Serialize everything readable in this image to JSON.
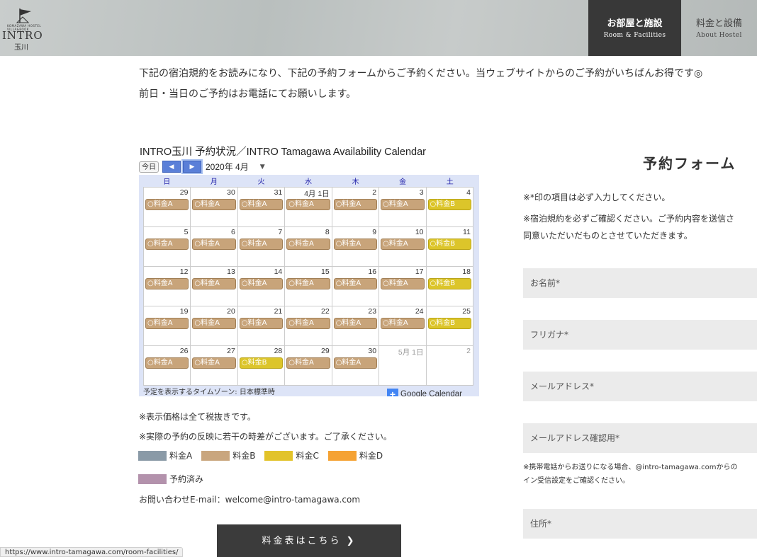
{
  "header": {
    "logo_small_text": "KOMAZAWA HOSTEL VILLA&BOOK",
    "logo_text": "INTRO",
    "logo_sub": "玉川",
    "nav": [
      {
        "jp": "お部屋と施設",
        "en": "Room & Facilities"
      },
      {
        "jp": "料金と設備",
        "en": "About Hostel"
      }
    ]
  },
  "intro": {
    "line1": "下記の宿泊規約をお読みになり、下記の予約フォームからご予約ください。当ウェブサイトからのご予約がいちばんお得です◎",
    "line2": "前日・当日のご予約はお電話にてお願いします。"
  },
  "calendar": {
    "title": "INTRO玉川 予約状況／INTRO Tamagawa Availability Calendar",
    "today_label": "今日",
    "prev_icon": "◀",
    "next_icon": "▶",
    "month_label": "2020年 4月",
    "dropdown_icon": "▼",
    "weekdays": [
      "日",
      "月",
      "火",
      "水",
      "木",
      "金",
      "土"
    ],
    "weeks": [
      [
        {
          "d": "29",
          "e": "○料金A",
          "t": "A"
        },
        {
          "d": "30",
          "e": "○料金A",
          "t": "A"
        },
        {
          "d": "31",
          "e": "○料金A",
          "t": "A"
        },
        {
          "d": "4月 1日",
          "e": "○料金A",
          "t": "A"
        },
        {
          "d": "2",
          "e": "○料金A",
          "t": "A"
        },
        {
          "d": "3",
          "e": "○料金A",
          "t": "A"
        },
        {
          "d": "4",
          "e": "○料金B",
          "t": "B"
        }
      ],
      [
        {
          "d": "5",
          "e": "○料金A",
          "t": "A"
        },
        {
          "d": "6",
          "e": "○料金A",
          "t": "A"
        },
        {
          "d": "7",
          "e": "○料金A",
          "t": "A"
        },
        {
          "d": "8",
          "e": "○料金A",
          "t": "A"
        },
        {
          "d": "9",
          "e": "○料金A",
          "t": "A"
        },
        {
          "d": "10",
          "e": "○料金A",
          "t": "A"
        },
        {
          "d": "11",
          "e": "○料金B",
          "t": "B"
        }
      ],
      [
        {
          "d": "12",
          "e": "○料金A",
          "t": "A"
        },
        {
          "d": "13",
          "e": "○料金A",
          "t": "A"
        },
        {
          "d": "14",
          "e": "○料金A",
          "t": "A"
        },
        {
          "d": "15",
          "e": "○料金A",
          "t": "A"
        },
        {
          "d": "16",
          "e": "○料金A",
          "t": "A"
        },
        {
          "d": "17",
          "e": "○料金A",
          "t": "A"
        },
        {
          "d": "18",
          "e": "○料金B",
          "t": "B"
        }
      ],
      [
        {
          "d": "19",
          "e": "○料金A",
          "t": "A"
        },
        {
          "d": "20",
          "e": "○料金A",
          "t": "A"
        },
        {
          "d": "21",
          "e": "○料金A",
          "t": "A"
        },
        {
          "d": "22",
          "e": "○料金A",
          "t": "A"
        },
        {
          "d": "23",
          "e": "○料金A",
          "t": "A"
        },
        {
          "d": "24",
          "e": "○料金A",
          "t": "A"
        },
        {
          "d": "25",
          "e": "○料金B",
          "t": "B"
        }
      ],
      [
        {
          "d": "26",
          "e": "○料金A",
          "t": "A"
        },
        {
          "d": "27",
          "e": "○料金A",
          "t": "A"
        },
        {
          "d": "28",
          "e": "○料金B",
          "t": "B"
        },
        {
          "d": "29",
          "e": "○料金A",
          "t": "A"
        },
        {
          "d": "30",
          "e": "○料金A",
          "t": "A"
        },
        {
          "d": "5月 1日",
          "e": "",
          "t": "",
          "other": true
        },
        {
          "d": "2",
          "e": "",
          "t": "",
          "other": true
        }
      ]
    ],
    "footer_text": "予定を表示するタイムゾーン: 日本標準時",
    "gcal_plus": "+",
    "gcal_label": "Google Calendar"
  },
  "notes": {
    "tax": "※表示価格は全て税抜きです。",
    "delay": "※実際の予約の反映に若干の時差がございます。ご了承ください。"
  },
  "legend": [
    {
      "label": "料金A",
      "color": "#8a9aa7"
    },
    {
      "label": "料金B",
      "color": "#c9a67e"
    },
    {
      "label": "料金C",
      "color": "#e2c32a"
    },
    {
      "label": "料金D",
      "color": "#f5a233"
    },
    {
      "label": "予約済み",
      "color": "#b392ac"
    }
  ],
  "contact": "お問い合わせE-mail：welcome@intro-tamagawa.com",
  "price_button": "料金表はこちら",
  "price_button_icon": "❯",
  "form": {
    "title": "予約フォーム",
    "note1": "※*印の項目は必ず入力してください。",
    "note2a": "※宿泊規約を必ずご確認ください。ご予約内容を送信さ",
    "note2b": "同意いただいだものとさせていただきます。",
    "fields": [
      "お名前*",
      "フリガナ*",
      "メールアドレス*",
      "メールアドレス確認用*",
      "住所*"
    ],
    "mobile_note_1": "※携帯電話からお送りになる場合、@intro-tamagawa.comからの",
    "mobile_note_2": "イン受信設定をご確認ください。"
  },
  "statusbar": "https://www.intro-tamagawa.com/room-facilities/"
}
